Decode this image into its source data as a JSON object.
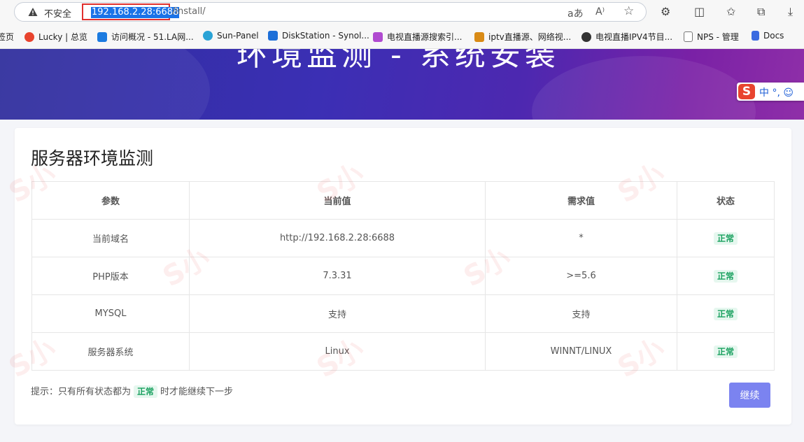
{
  "browser": {
    "insecure_label": "不安全",
    "url_host": "192.168.2.28:6688",
    "url_path": "/install/",
    "icons": [
      "warning-icon",
      "read-aloud-icon",
      "text-icon",
      "favorite-star-icon",
      "extensions-icon",
      "split-screen-icon",
      "favorites-icon",
      "collections-icon",
      "download-icon"
    ]
  },
  "bookmarks": [
    {
      "label": "签页",
      "color": "#888888"
    },
    {
      "label": "Lucky | 总览",
      "color": "#e8442e"
    },
    {
      "label": "访问概况 - 51.LA网...",
      "color": "#1c7be0"
    },
    {
      "label": "Sun-Panel",
      "color": "#2aa3d6"
    },
    {
      "label": "DiskStation - Synol...",
      "color": "#1d6fd8"
    },
    {
      "label": "电视直播源搜索引...",
      "color": "#b04bd0"
    },
    {
      "label": "iptv直播源、网络视...",
      "color": "#d98b16"
    },
    {
      "label": "电视直播IPV4节目...",
      "color": "#333333"
    },
    {
      "label": "NPS - 管理",
      "color": "#777777"
    },
    {
      "label": "Docs",
      "color": "#3b6be0"
    }
  ],
  "hero": {
    "title": "环境监测 - 系统安装"
  },
  "ime": {
    "logo": "S",
    "text": "中 °, ☺"
  },
  "card": {
    "title": "服务器环境监测",
    "headers": [
      "参数",
      "当前值",
      "需求值",
      "状态"
    ],
    "rows": [
      {
        "param": "当前域名",
        "current": "http://192.168.2.28:6688",
        "required": "*",
        "status": "正常"
      },
      {
        "param": "PHP版本",
        "current": "7.3.31",
        "required": ">=5.6",
        "status": "正常"
      },
      {
        "param": "MYSQL",
        "current": "支持",
        "required": "支持",
        "status": "正常"
      },
      {
        "param": "服务器系统",
        "current": "Linux",
        "required": "WINNT/LINUX",
        "status": "正常"
      }
    ],
    "tip_prefix": "提示：只有所有状态都为",
    "tip_badge": "正常",
    "tip_suffix": "时才能继续下一步",
    "next_button": "继续"
  },
  "colors": {
    "accent_button": "#7b83f0",
    "status_ok": "#19a15f",
    "highlight_border": "#e0302e"
  }
}
